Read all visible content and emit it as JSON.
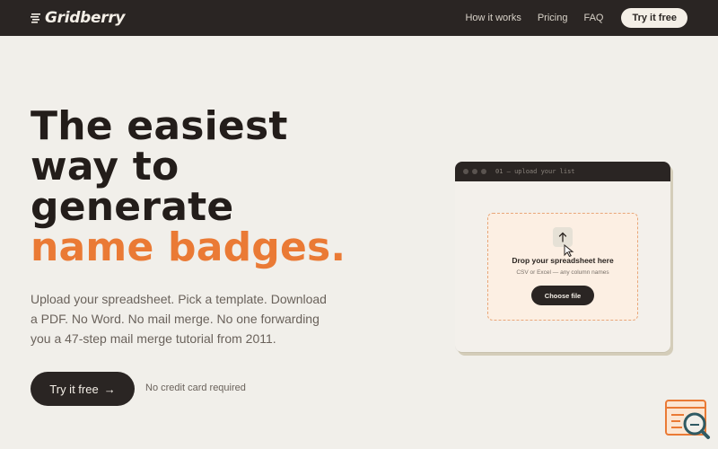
{
  "header": {
    "brand": "Gridberry",
    "nav": [
      {
        "label": "How it works"
      },
      {
        "label": "Pricing"
      },
      {
        "label": "FAQ"
      }
    ],
    "cta_label": "Try it free"
  },
  "hero": {
    "title_lines": [
      "The easiest",
      "way to",
      "generate"
    ],
    "title_accent": "name badges.",
    "subtitle": "Upload your spreadsheet. Pick a template. Download a PDF. No Word. No mail merge. No one forwarding you a 47-step mail merge tutorial from 2011.",
    "cta_label": "Try it free",
    "cta_arrow": "→",
    "cta_note": "No credit card required"
  },
  "mockup": {
    "window_title": "01 — upload your list",
    "drop_title": "Drop your spreadsheet here",
    "drop_sub": "CSV or Excel — any column names",
    "button_label": "Choose file"
  },
  "colors": {
    "accent": "#ea7a35",
    "dark": "#2a2523",
    "background": "#f1efea"
  },
  "icons": [
    "logo-mark-icon",
    "upload-arrow-icon",
    "mouse-cursor-icon",
    "search-chat-icon"
  ]
}
